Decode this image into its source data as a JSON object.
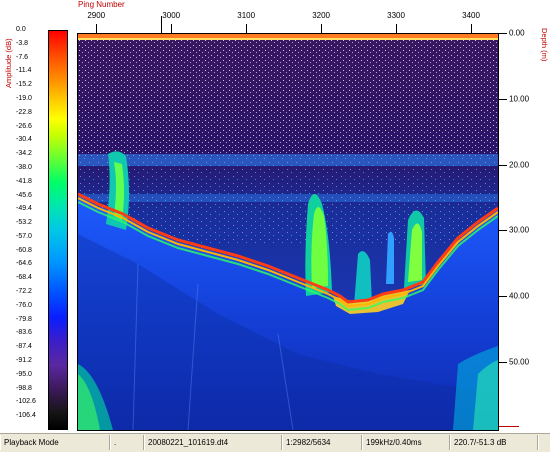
{
  "ping_axis": {
    "title": "Ping Number",
    "ticks": [
      "2900",
      "3000",
      "3100",
      "3200",
      "3300",
      "3400"
    ],
    "tick_values": [
      2900,
      3000,
      3100,
      3200,
      3300,
      3400
    ],
    "range": [
      2873,
      3436
    ]
  },
  "amplitude_scale": {
    "title": "Amplitude (dB)",
    "labels": [
      "0.0",
      "-3.8",
      "-7.6",
      "-11.4",
      "-15.2",
      "-19.0",
      "-22.8",
      "-26.6",
      "-30.4",
      "-34.2",
      "-38.0",
      "-41.8",
      "-45.6",
      "-49.4",
      "-53.2",
      "-57.0",
      "-60.8",
      "-64.6",
      "-68.4",
      "-72.2",
      "-76.0",
      "-79.8",
      "-83.6",
      "-87.4",
      "-91.2",
      "-95.0",
      "-98.8",
      "-102.6",
      "-106.4"
    ],
    "range": [
      0.0,
      -110.2
    ]
  },
  "depth_axis": {
    "title": "Depth (m)",
    "ticks": [
      "0.00",
      "10.00",
      "20.00",
      "30.00",
      "40.00",
      "50.00"
    ],
    "tick_values": [
      0,
      10,
      20,
      30,
      40,
      50
    ],
    "range": [
      0,
      60.5
    ]
  },
  "status": {
    "mode": "Playback Mode",
    "dot": ".",
    "file": "20080221_101619.dt4",
    "ping": "1:2982/5634",
    "freq": "199kHz/0.40ms",
    "range": "220.7/-51.3 dB"
  },
  "colors": {
    "axis_title": "#c00000",
    "status_bg": "#ece9d8",
    "bottom_echo": "#ff3c14"
  }
}
